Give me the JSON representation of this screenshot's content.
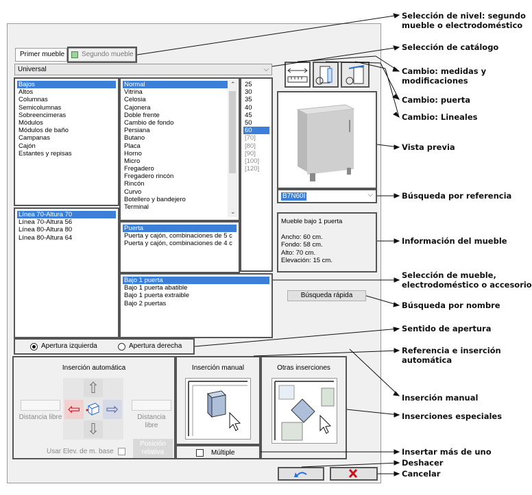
{
  "tabs": {
    "first": "Primer mueble",
    "second": "Segundo mueble"
  },
  "catalog": {
    "value": "Universal"
  },
  "categories": [
    "Bajos",
    "Altos",
    "Columnas",
    "Semicolumnas",
    "Sobreencimeras",
    "Módulos",
    "Módulos de baño",
    "Campanas",
    "Cajón",
    "Estantes y repisas"
  ],
  "types": [
    "Normal",
    "Vitrina",
    "Celosia",
    "Cajonera",
    "Doble frente",
    "Cambio de fondo",
    "Persiana",
    "Butano",
    "Placa",
    "Horno",
    "Micro",
    "Fregadero",
    "Fregadero rincón",
    "Rincón",
    "Curvo",
    "Botellero y bandejero",
    "Terminal"
  ],
  "widths": [
    "25",
    "30",
    "35",
    "40",
    "45",
    "50",
    "60",
    "[70]",
    "[80]",
    "[90]",
    "[100]",
    "[120]"
  ],
  "lines": [
    "Línea 70-Altura 70",
    "Línea 70-Altura 56",
    "Línea 80-Altura 80",
    "Línea 80-Altura 64"
  ],
  "fronts": [
    "Puerta",
    "Puerta y cajón, combinaciones de 5 c",
    "Puerta y cajón, combinaciones de 4 c"
  ],
  "models": [
    "Bajo 1 puerta",
    "Bajo 1 puerta abatible",
    "Bajo 1 puerta extraible",
    "Bajo 2 puertas"
  ],
  "reference": {
    "value": "B7N60I"
  },
  "info": {
    "title": "Mueble bajo 1 puerta",
    "ancho": "Ancho: 60 cm.",
    "fondo": "Fondo: 58 cm.",
    "alto": "Alto: 70 cm.",
    "elev": "Elevación: 15 cm."
  },
  "quick_search": "Búsqueda rápida",
  "opening": {
    "left": "Apertura izquierda",
    "right": "Apertura derecha"
  },
  "auto_insert": {
    "title": "Inserción automática",
    "dist_left": "Distancia libre",
    "dist_right": "Distancia libre",
    "use_base": "Usar Elev. de m. base",
    "relative": "Posición relativa"
  },
  "manual_insert": {
    "title": "Inserción manual"
  },
  "other_insert": {
    "title": "Otras inserciones"
  },
  "multiple": "Múltiple",
  "annotations": {
    "level": "Selección de nivel: segundo mueble o electrodoméstico",
    "catalog": "Selección de catálogo",
    "measures": "Cambio: medidas y modificaciones",
    "door": "Cambio: puerta",
    "linear": "Cambio: Lineales",
    "preview": "Vista previa",
    "reference": "Búsqueda por referencia",
    "info": "Información del mueble",
    "selection": "Selección de mueble, electrodoméstico o accesorio",
    "name": "Búsqueda por nombre",
    "opening": "Sentido de apertura",
    "ref_auto": "Referencia e inserción automática",
    "manual": "Inserción manual",
    "special": "Inserciones especiales",
    "multiple": "Insertar más de uno",
    "undo": "Deshacer",
    "cancel": "Cancelar"
  },
  "colors": {
    "selection": "#3b7fd8",
    "cancel": "#c8141c",
    "undo": "#2a6fd6"
  }
}
